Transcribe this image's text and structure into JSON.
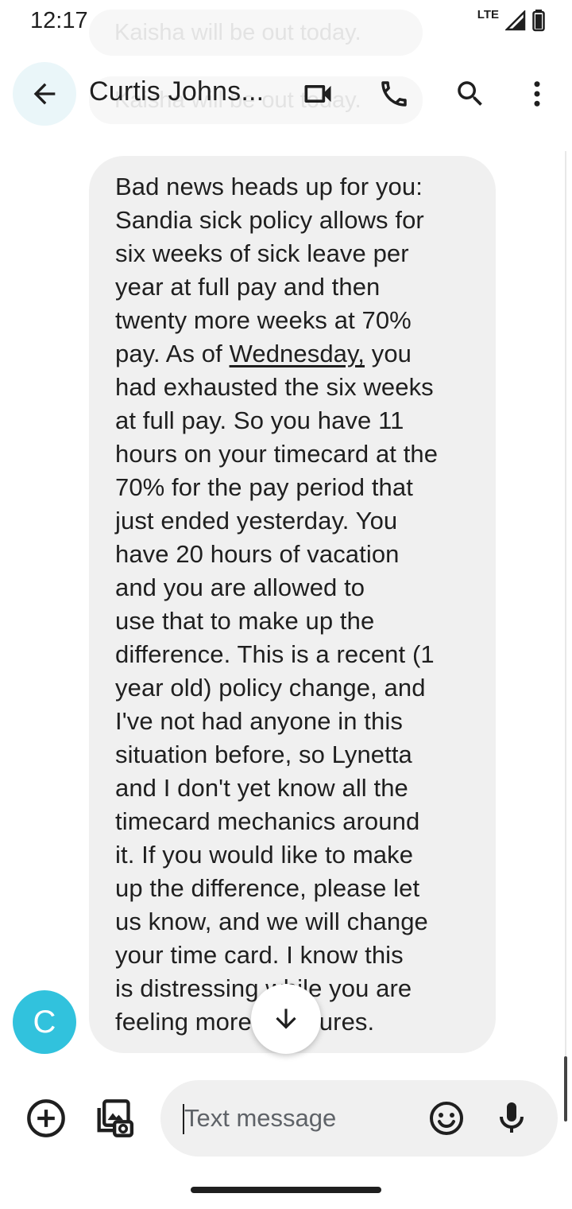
{
  "status_bar": {
    "time": "12:17",
    "network": "LTE"
  },
  "notification_ghost": {
    "text": "Kaisha will be out today."
  },
  "header": {
    "contact_name": "Curtis Johns...",
    "icons": [
      "back-arrow-icon",
      "video-call-icon",
      "phone-icon",
      "search-icon",
      "more-vert-icon"
    ]
  },
  "message": {
    "text_before": "Bad news heads up for you:\nSandia sick policy allows for\nsix weeks of sick leave per\nyear at full pay and then\ntwenty more weeks at 70%\npay.  As of ",
    "link_text": "Wednesday,",
    "text_after": " you\nhad exhausted the six weeks\nat full pay.  So you have 11\nhours on your timecard at the\n70% for the pay period that\njust ended yesterday.  You\nhave 20 hours of vacation\nand you are allowed to\nuse that to make up the\ndifference.  This is a recent (1\nyear old) policy change, and\nI've not had anyone in this\nsituation before, so Lynetta\nand I don't yet know all the\ntimecard mechanics around\nit.  If you would like to make\nup the difference, please let\nus know, and we will change\nyour time card.  I know this\nis distressing while you are\nfeeling more pressures."
  },
  "avatar": {
    "initial": "C",
    "color": "#31c2dd"
  },
  "compose": {
    "placeholder": "Text message"
  },
  "colors": {
    "bubble": "#f0f0f0",
    "accent": "#31c2dd"
  }
}
